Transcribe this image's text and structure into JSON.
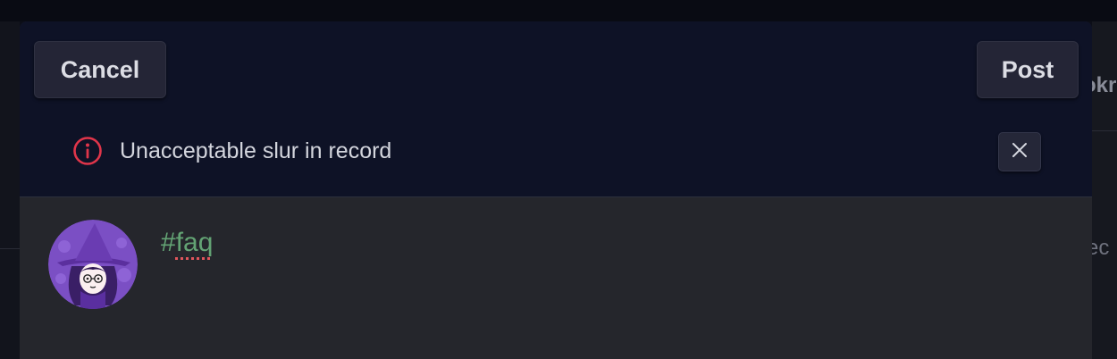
{
  "composer": {
    "cancel_label": "Cancel",
    "post_label": "Post",
    "alert": {
      "icon": "info-circle-icon",
      "message": "Unacceptable slur in record",
      "close_icon": "close-icon"
    },
    "avatar": "witch-avatar",
    "text_prefix": "#",
    "text_word": "faq"
  },
  "background": {
    "right_text_top": "okr",
    "right_text_bottom": "ec"
  },
  "colors": {
    "header_bg": "#0e1226",
    "composer_bg": "#25262c",
    "hashtag": "#63a374",
    "alert_icon": "#e0354a",
    "spellcheck": "#e0565c"
  }
}
